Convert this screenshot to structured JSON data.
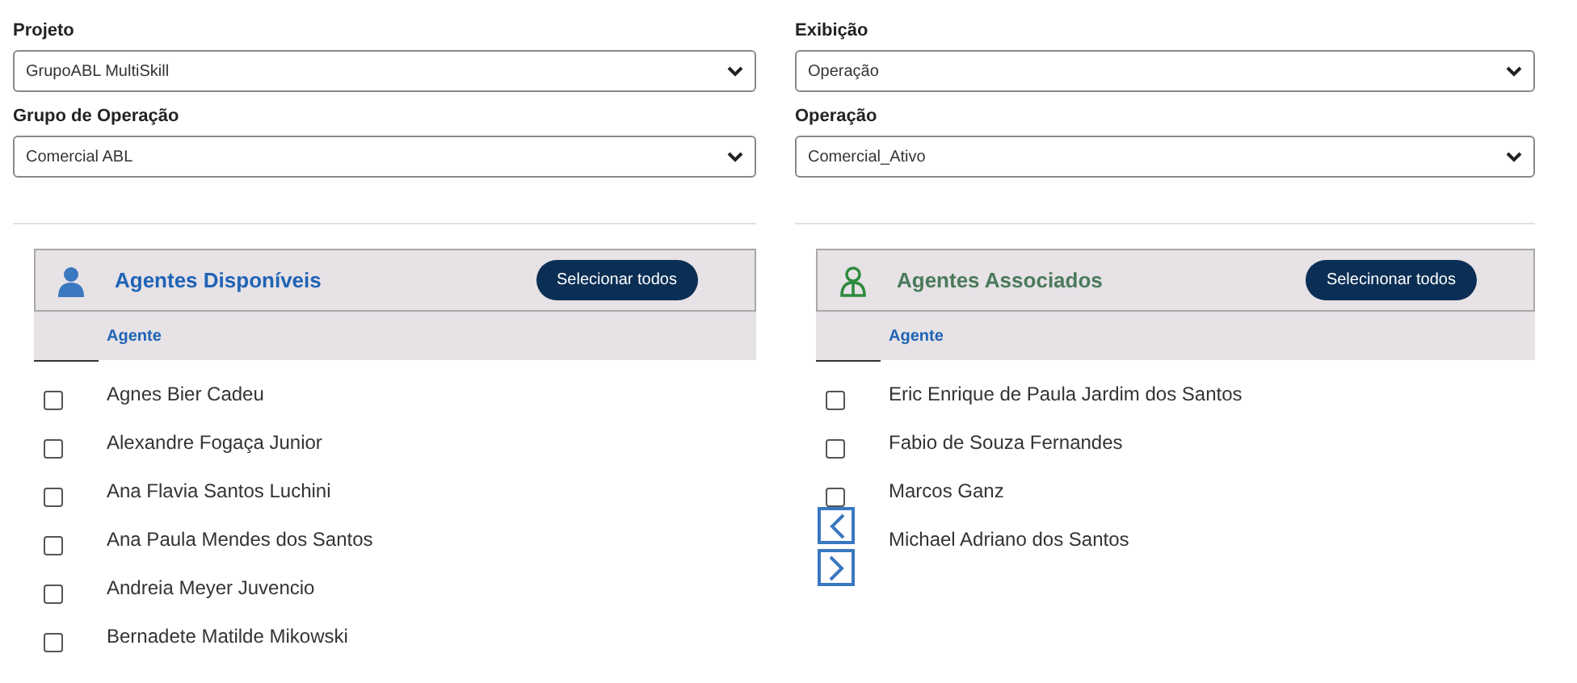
{
  "filters": [
    {
      "label": "Projeto",
      "value": "GrupoABL MultiSkill"
    },
    {
      "label": "Exibição",
      "value": "Operação"
    },
    {
      "label": "Grupo de Operação",
      "value": "Comercial ABL"
    },
    {
      "label": "Operação",
      "value": "Comercial_Ativo"
    }
  ],
  "panels": [
    {
      "kind": "available",
      "title": "Agentes Disponíveis",
      "button": "Selecionar todos",
      "column": "Agente",
      "rows": [
        {
          "name": "Agnes Bier Cadeu",
          "checked": false
        },
        {
          "name": "Alexandre Fogaça Junior",
          "checked": false
        },
        {
          "name": "Ana Flavia Santos Luchini",
          "checked": false
        },
        {
          "name": "Ana Paula Mendes dos Santos",
          "checked": false
        },
        {
          "name": "Andreia Meyer Juvencio",
          "checked": false
        },
        {
          "name": "Bernadete Matilde Mikowski",
          "checked": false
        }
      ]
    },
    {
      "kind": "associated",
      "title": "Agentes Associados",
      "button": "Selecinonar todos",
      "column": "Agente",
      "rows": [
        {
          "name": "Eric Enrique de Paula Jardim dos Santos",
          "checked": false
        },
        {
          "name": "Fabio de Souza Fernandes",
          "checked": false
        },
        {
          "name": "Marcos Ganz",
          "checked": false
        },
        {
          "name": "Michael Adriano dos Santos"
        }
      ]
    }
  ]
}
